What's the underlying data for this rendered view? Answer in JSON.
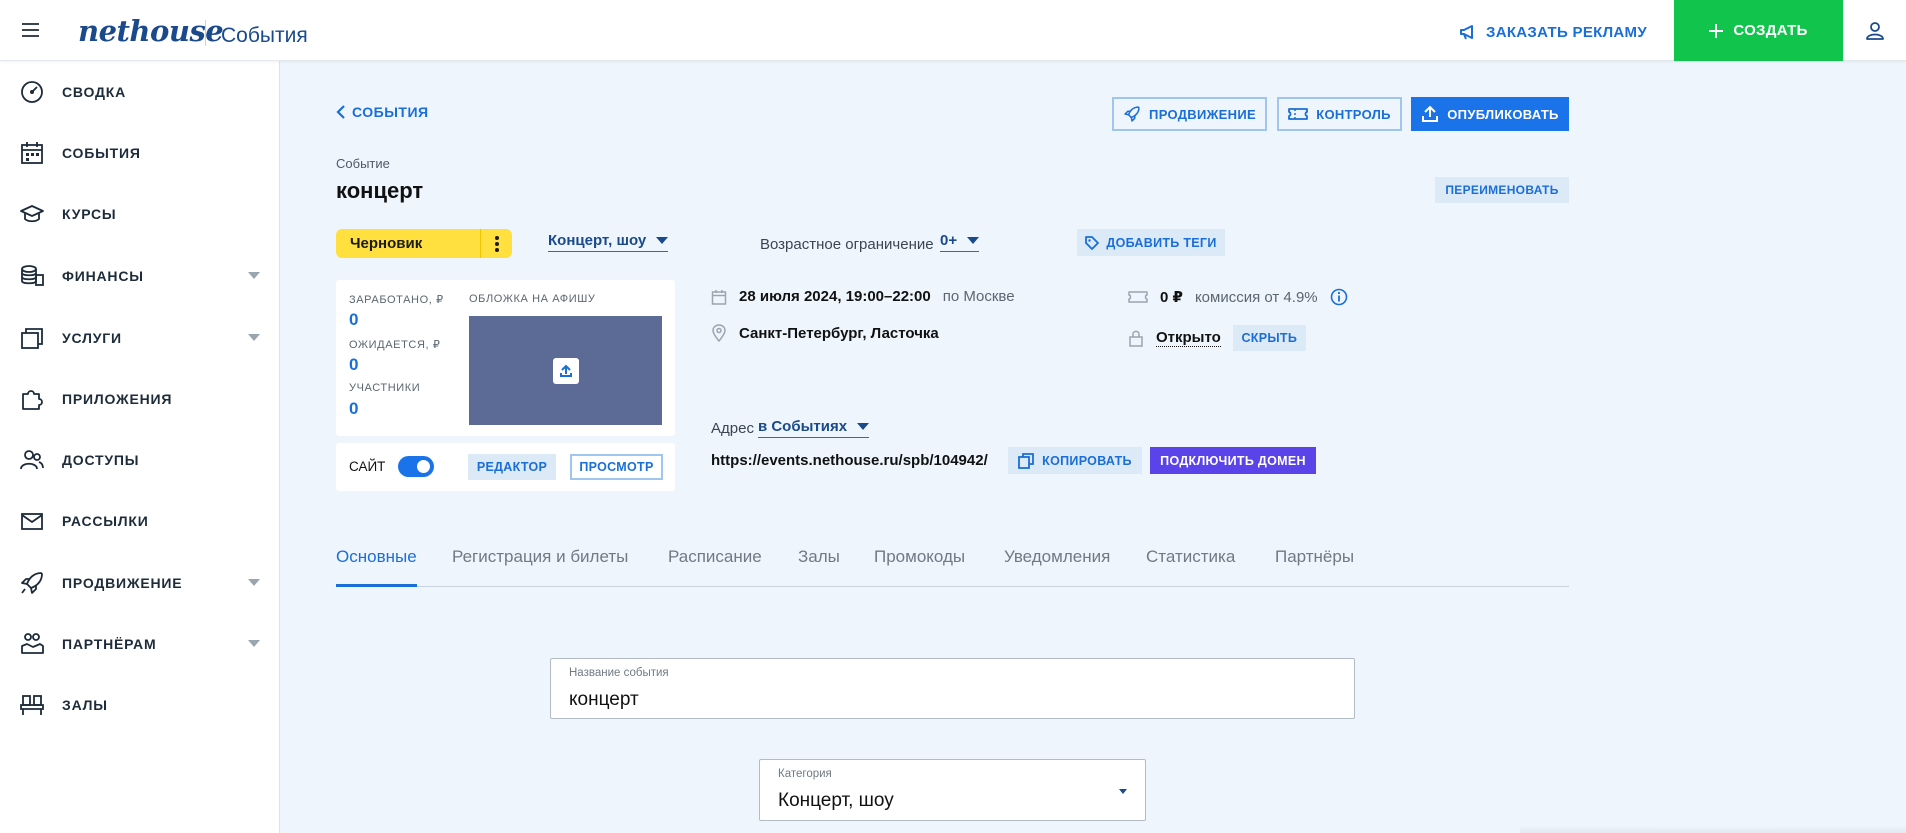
{
  "header": {
    "logo_text": "nethouse",
    "app_title": "События",
    "ad_link": "ЗАКАЗАТЬ РЕКЛАМУ",
    "create_button": "СОЗДАТЬ",
    "create_button_color": "#10c44c"
  },
  "sidebar": {
    "items": [
      {
        "label": "СВОДКА",
        "icon": "dashboard-gauge-icon"
      },
      {
        "label": "СОБЫТИЯ",
        "icon": "calendar-icon"
      },
      {
        "label": "КУРСЫ",
        "icon": "graduation-cap-icon"
      },
      {
        "label": "ФИНАНСЫ",
        "icon": "coins-icon",
        "expandable": true
      },
      {
        "label": "УСЛУГИ",
        "icon": "services-icon",
        "expandable": true
      },
      {
        "label": "ПРИЛОЖЕНИЯ",
        "icon": "puzzle-icon"
      },
      {
        "label": "ДОСТУПЫ",
        "icon": "users-icon"
      },
      {
        "label": "РАССЫЛКИ",
        "icon": "mail-icon"
      },
      {
        "label": "ПРОДВИЖЕНИЕ",
        "icon": "rocket-icon",
        "expandable": true
      },
      {
        "label": "ПАРТНЁРАМ",
        "icon": "partners-icon",
        "expandable": true
      },
      {
        "label": "ЗАЛЫ",
        "icon": "seats-icon"
      }
    ]
  },
  "main": {
    "back_link": "СОБЫТИЯ",
    "toolbar": {
      "promotion": "ПРОДВИЖЕНИЕ",
      "control": "КОНТРОЛЬ",
      "publish": "ОПУБЛИКОВАТЬ"
    },
    "event_caption": "Событие",
    "event_name": "концерт",
    "rename": "ПЕРЕИМЕНОВАТЬ",
    "status": "Черновик",
    "status_color": "#ffe03e",
    "category_link": "Концерт, шоу",
    "age_label": "Возрастное ограничение",
    "age_value": "0+",
    "add_tags": "ДОБАВИТЬ ТЕГИ",
    "stats": {
      "earned_label": "ЗАРАБОТАНО, ₽",
      "earned_value": "0",
      "expected_label": "ОЖИДАЕТСЯ, ₽",
      "expected_value": "0",
      "participants_label": "УЧАСТНИКИ",
      "participants_value": "0",
      "cover_label": "ОБЛОЖКА НА АФИШУ"
    },
    "site": {
      "label": "САЙТ",
      "enabled": true,
      "editor": "РЕДАКТОР",
      "preview": "ПРОСМОТР"
    },
    "datetime": "28 июля 2024, 19:00–22:00",
    "timezone": "по Москве",
    "location": "Санкт-Петербург, Ласточка",
    "price": "0 ₽",
    "commission": "комиссия от 4.9%",
    "access": "Открыто",
    "hide": "СКРЫТЬ",
    "address_label": "Адрес",
    "address_scope": "в Событиях",
    "url": "https://events.nethouse.ru/spb/104942/",
    "copy": "КОПИРОВАТЬ",
    "connect_domain": "ПОДКЛЮЧИТЬ ДОМЕН",
    "tabs": [
      {
        "label": "Основные",
        "active": true
      },
      {
        "label": "Регистрация и билеты"
      },
      {
        "label": "Расписание"
      },
      {
        "label": "Залы"
      },
      {
        "label": "Промокоды"
      },
      {
        "label": "Уведомления"
      },
      {
        "label": "Статистика"
      },
      {
        "label": "Партнёры"
      }
    ],
    "form": {
      "name_label": "Название события",
      "name_value": "концерт",
      "category_label": "Категория",
      "category_value": "Концерт, шоу"
    }
  },
  "colors": {
    "accent": "#1a6ed8",
    "background": "#eef5fd",
    "domain_button": "#5a43e8"
  }
}
